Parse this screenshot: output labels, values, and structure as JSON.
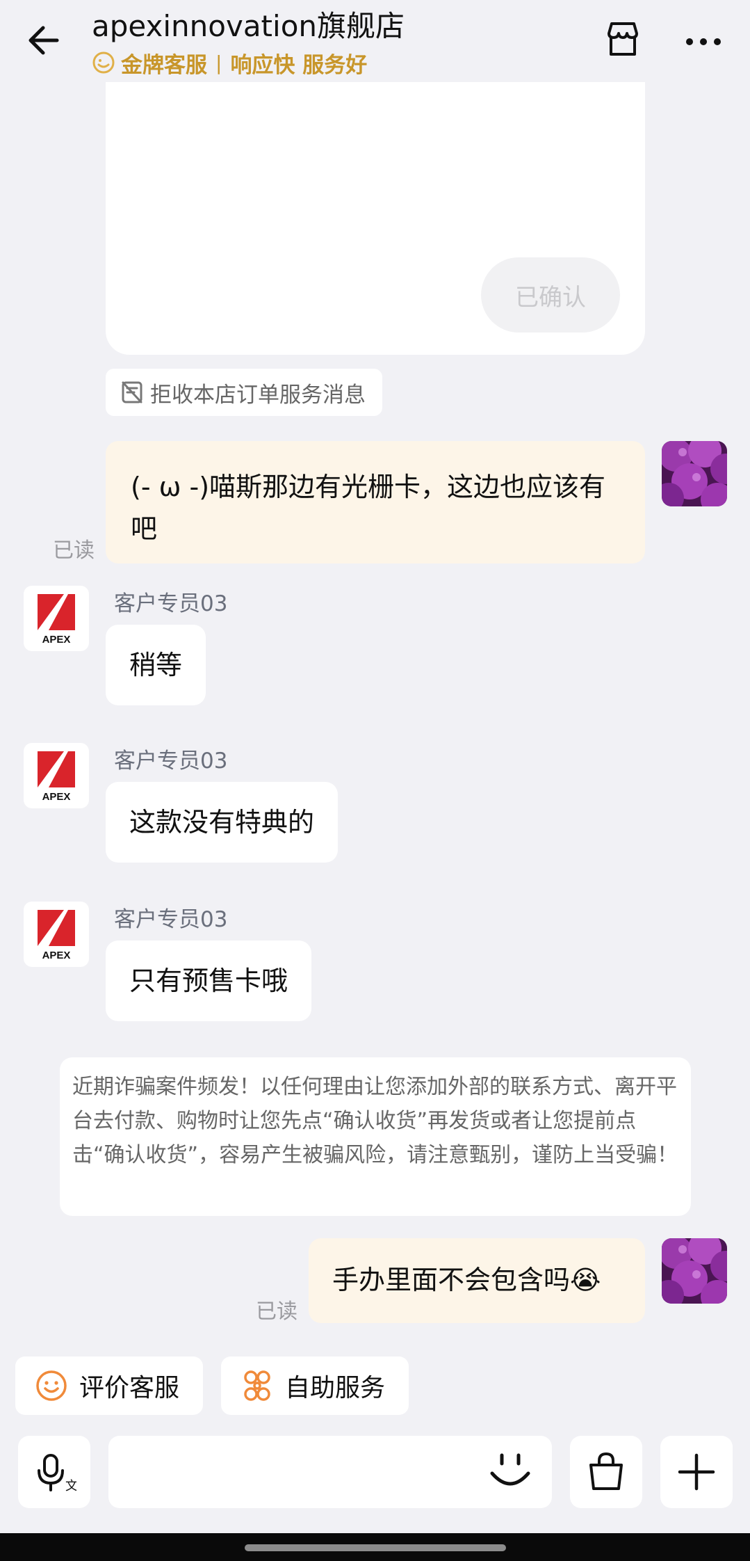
{
  "header": {
    "shop_name": "apexinnovation旗舰店",
    "badge": "金牌客服",
    "tagline": "响应快 服务好"
  },
  "card": {
    "confirmed_label": "已确认"
  },
  "reject_label": "拒收本店订单服务消息",
  "messages": [
    {
      "from": "me",
      "text": "(- ω -)喵斯那边有光栅卡，这边也应该有吧",
      "status": "已读"
    },
    {
      "from": "them",
      "sender": "客户专员03",
      "text": "稍等"
    },
    {
      "from": "them",
      "sender": "客户专员03",
      "text": "这款没有特典的"
    },
    {
      "from": "them",
      "sender": "客户专员03",
      "text": "只有预售卡哦"
    },
    {
      "from": "me",
      "text": "手办里面不会包含吗",
      "emoji": "😭",
      "status": "已读"
    }
  ],
  "notice": "近期诈骗案件频发！以任何理由让您添加外部的联系方式、离开平台去付款、购物时让您先点“确认收货”再发货或者让您提前点击“确认收货”，容易产生被骗风险，请注意甄别，谨防上当受骗！",
  "quick_actions": [
    {
      "label": "评价客服",
      "icon": "smiley-icon"
    },
    {
      "label": "自助服务",
      "icon": "grid-flower-icon"
    }
  ],
  "apex_logo_text": "APEX",
  "colors": {
    "accent_gold": "#c8962a",
    "my_bubble": "#fdf5e8",
    "background": "#f1f1f5",
    "apex_red": "#d9242b",
    "avatar_purple": "#8a2d9c"
  }
}
